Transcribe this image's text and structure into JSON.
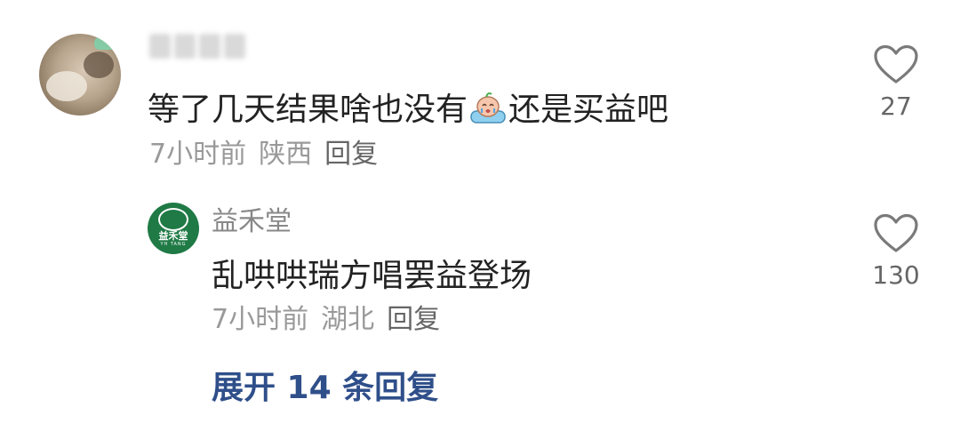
{
  "comment": {
    "text_before_emoji": "等了几天结果啥也没有",
    "emoji": "crying-bath-emoji",
    "text_after_emoji": "还是买益吧",
    "time": "7小时前",
    "location": "陕西",
    "reply_label": "回复",
    "like_count": "27"
  },
  "reply": {
    "author": "益禾堂",
    "avatar_brand": "益禾堂",
    "avatar_sub": "YH TANG",
    "text": "乱哄哄瑞方唱罢益登场",
    "time": "7小时前",
    "location": "湖北",
    "reply_label": "回复",
    "like_count": "130"
  },
  "expand": {
    "label": "展开 14 条回复"
  },
  "colors": {
    "text_primary": "#222222",
    "text_meta": "#999999",
    "link_blue": "#2f4f8a",
    "brand_green": "#1f7a45"
  }
}
